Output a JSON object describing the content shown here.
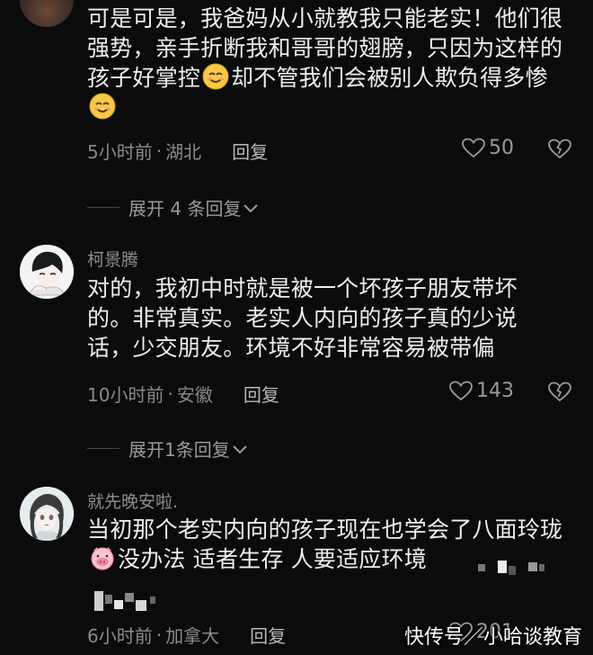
{
  "comments": [
    {
      "content_parts": [
        "可是可是，我爸妈从小就教我只能老实！他们很强势，亲手折断我和哥哥的翅膀，只因为这样的孩子好掌控",
        "却不管我们会被别人欺负得多惨",
        ""
      ],
      "time": "5小时前",
      "location": "湖北",
      "reply_label": "回复",
      "likes": "50",
      "expand_label": "展开 4 条回复"
    },
    {
      "author": "柯景腾",
      "content": "对的，我初中时就是被一个坏孩子朋友带坏的。非常真实。老实人内向的孩子真的少说话，少交朋友。环境不好非常容易被带偏",
      "time": "10小时前",
      "location": "安徽",
      "reply_label": "回复",
      "likes": "143",
      "expand_label": "展开1条回复"
    },
    {
      "author": "就先晚安啦.",
      "content_parts": [
        "当初那个老实内向的孩子现在也学会了八面玲珑",
        "没办法 适者生存 人要适应环境"
      ],
      "time": "6小时前",
      "location": "加拿大",
      "reply_label": "回复",
      "likes": "201"
    }
  ],
  "separator": "·",
  "icons": {
    "like": "heart-outline-icon",
    "dislike": "broken-heart-icon",
    "expand": "chevron-down-icon",
    "emoji_smile": "smiling-face-emoji",
    "emoji_pig": "pig-face-emoji"
  },
  "watermark": "快传号／小哈谈教育",
  "colors": {
    "background": "#0b0b0b",
    "text": "#eeeeee",
    "meta": "#8a8a8a",
    "author": "#8d8d8d"
  }
}
